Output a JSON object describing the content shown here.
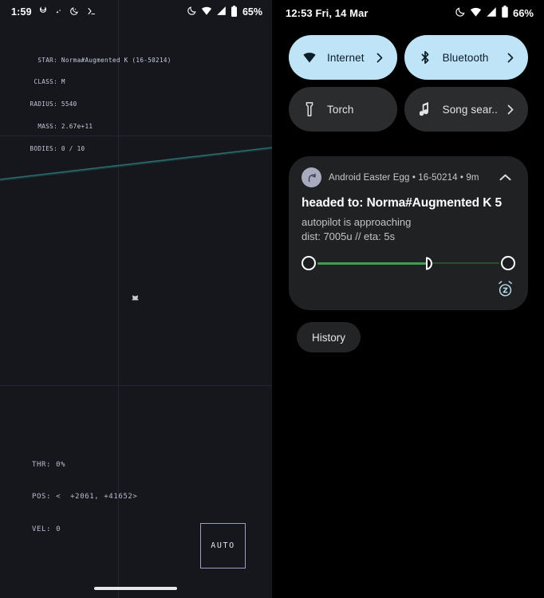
{
  "left_panel": {
    "status_bar": {
      "time": "1:59",
      "left_icons": [
        "moon-spiral-icon",
        "dot-icon",
        "dnd-moon-icon",
        "terminal-prompt-icon"
      ],
      "right_icons": [
        "dnd-moon-icon",
        "wifi-icon",
        "cell-signal-icon",
        "battery-icon"
      ],
      "battery_percent": "65%"
    },
    "readout": {
      "rows": [
        {
          "label": "STAR:",
          "value": "Norma#Augmented K (16-50214)"
        },
        {
          "label": "CLASS:",
          "value": "M"
        },
        {
          "label": "RADIUS:",
          "value": "5540"
        },
        {
          "label": "MASS:",
          "value": "2.67e+11"
        },
        {
          "label": "BODIES:",
          "value": "0 / 10"
        }
      ],
      "star": "Norma#Augmented K (16-50214)",
      "class": "M",
      "radius": "5540",
      "mass": "2.67e+11",
      "bodies": "0 / 10"
    },
    "hud": {
      "thr_label": "THR:",
      "thr_value": "0%",
      "pos_label": "POS:",
      "pos_value": "<  +2061, +41652>",
      "vel_label": "VEL:",
      "vel_value": "0",
      "lines": "THR: 0%\nPOS: <  +2061, +41652>\nVEL: 0"
    },
    "auto_button": "AUTO",
    "colors": {
      "background": "#15171d",
      "trajectory": "#2d6b6e",
      "grid": "#222634",
      "hud_text": "#b9bccf"
    }
  },
  "right_panel": {
    "status_bar": {
      "time": "12:53",
      "date": "Fri, 14 Mar",
      "datetime": "12:53   Fri, 14 Mar",
      "right_icons": [
        "dnd-moon-icon",
        "wifi-icon",
        "cell-signal-icon",
        "battery-icon"
      ],
      "battery_percent": "66%"
    },
    "quick_settings": {
      "tiles": [
        {
          "label": "Internet",
          "icon": "wifi-icon",
          "state": "on",
          "chevron": true
        },
        {
          "label": "Bluetooth",
          "icon": "bluetooth-icon",
          "state": "on",
          "chevron": true
        },
        {
          "label": "Torch",
          "icon": "flashlight-icon",
          "state": "off",
          "chevron": false
        },
        {
          "label": "Song sear..",
          "icon": "music-note-icon",
          "state": "off",
          "chevron": true
        }
      ]
    },
    "notification": {
      "app_name": "Android Easter Egg",
      "id": "16-50214",
      "age": "9m",
      "header": "Android Easter Egg • 16-50214 • 9m",
      "title": "headed to: Norma#Augmented K 5",
      "body_line1": "autopilot is approaching",
      "body_line2": "dist: 7005u // eta: 5s",
      "progress_percent": 62,
      "snooze_icon": "alarm-snooze-icon",
      "collapse_icon": "chevron-up-icon"
    },
    "history_button": "History",
    "colors": {
      "tile_on_bg": "#bfe4f8",
      "tile_off_bg": "#2a2c2e",
      "notification_bg": "#1f2123",
      "progress_fill": "#3f9e52",
      "snooze_accent": "#b9dcf0"
    }
  }
}
